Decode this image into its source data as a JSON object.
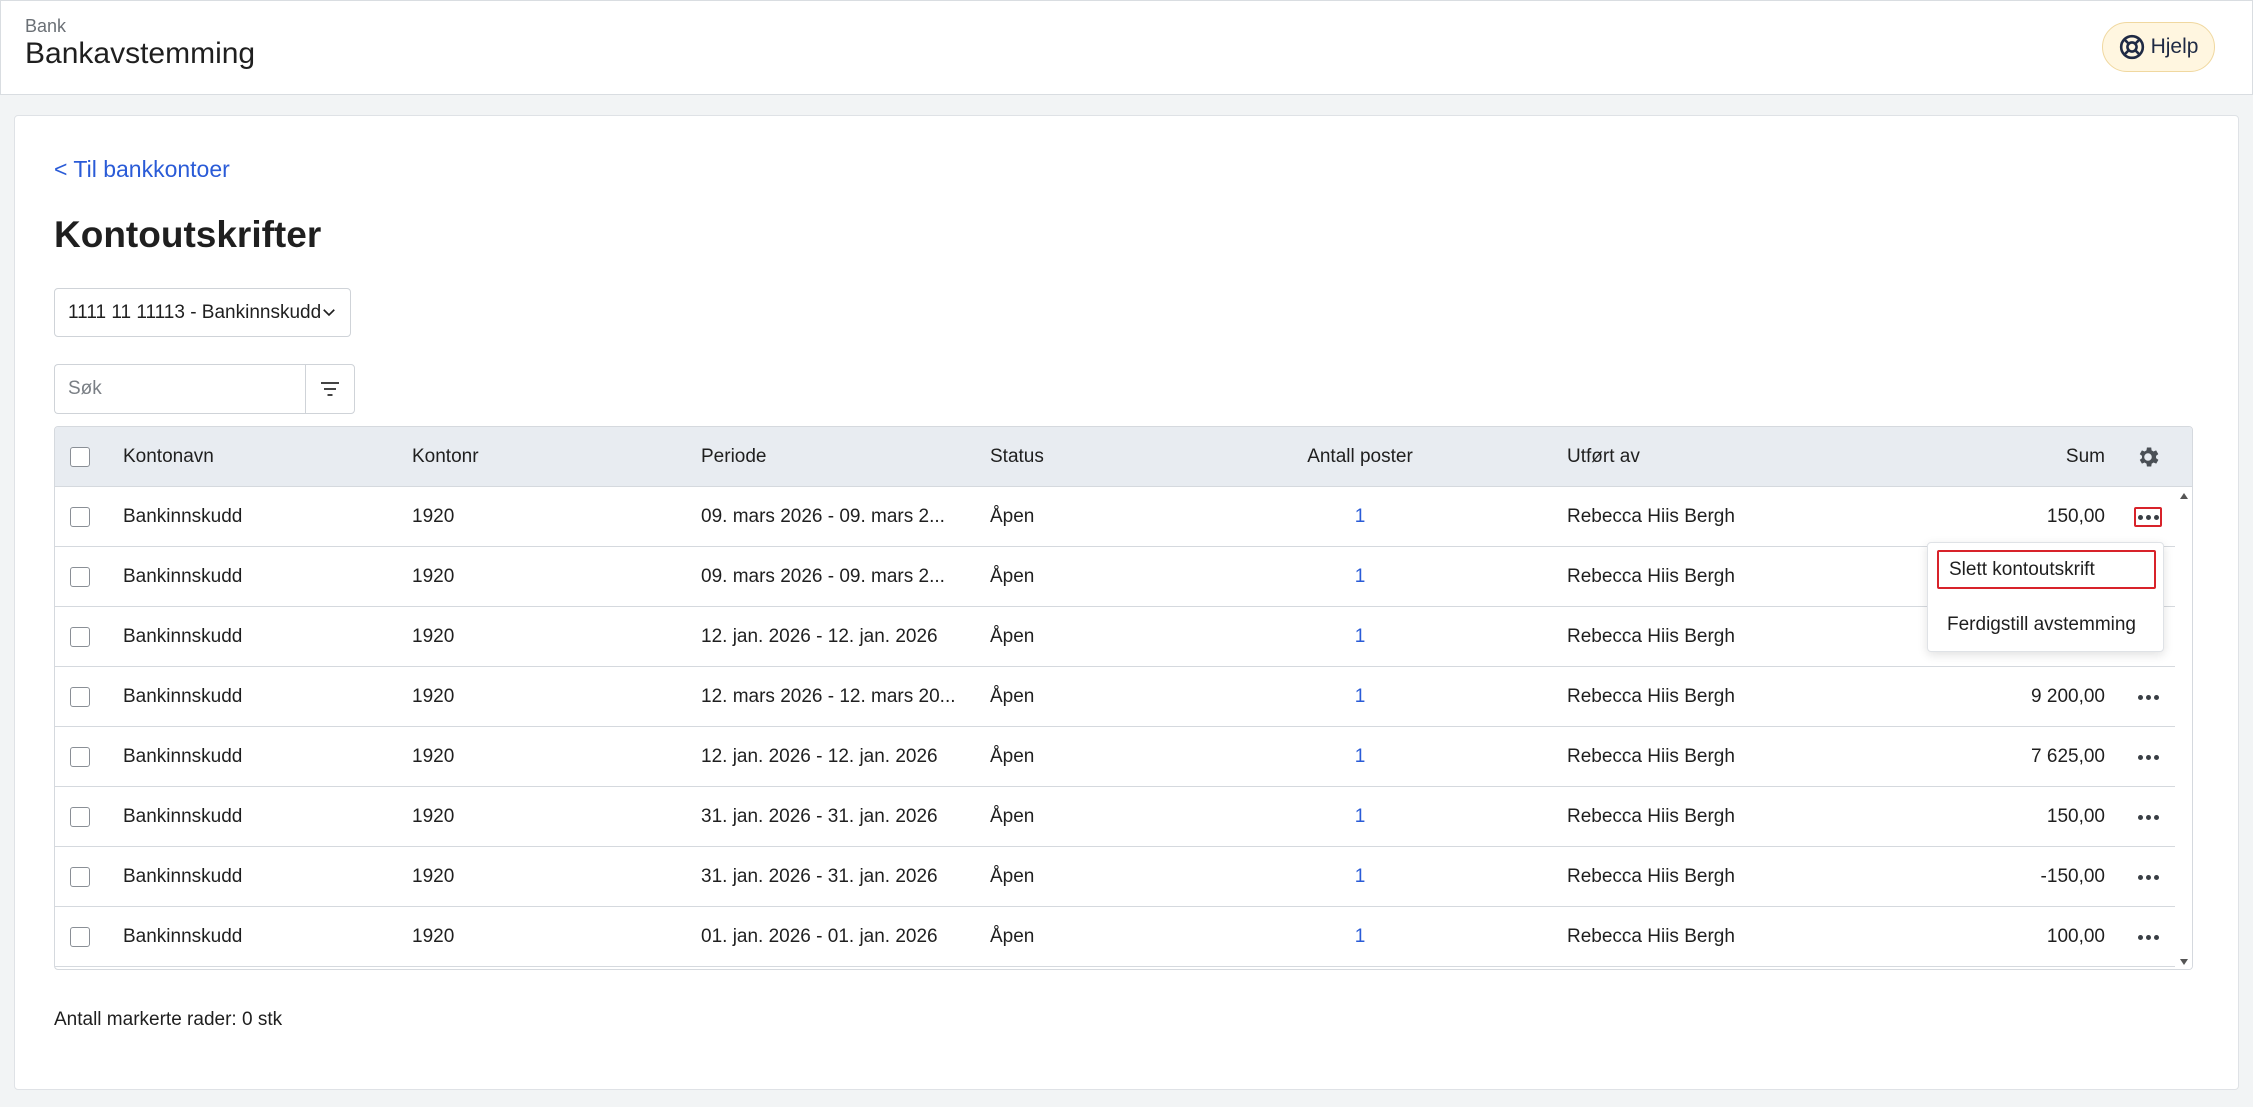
{
  "header": {
    "breadcrumb": "Bank",
    "title": "Bankavstemming",
    "help_label": "Hjelp"
  },
  "main": {
    "back_link": "< Til bankkontoer",
    "page_title": "Kontoutskrifter",
    "account_select": "1111 11 11113 - Bankinnskudd",
    "search_placeholder": "Søk"
  },
  "table": {
    "headers": {
      "kontonavn": "Kontonavn",
      "kontonr": "Kontonr",
      "periode": "Periode",
      "status": "Status",
      "antall": "Antall poster",
      "utfort": "Utført av",
      "sum": "Sum"
    },
    "rows": [
      {
        "kontonavn": "Bankinnskudd",
        "kontonr": "1920",
        "periode": "09. mars 2026 - 09. mars 2...",
        "status": "Åpen",
        "antall": "1",
        "utfort": "Rebecca Hiis Bergh",
        "sum": "150,00"
      },
      {
        "kontonavn": "Bankinnskudd",
        "kontonr": "1920",
        "periode": "09. mars 2026 - 09. mars 2...",
        "status": "Åpen",
        "antall": "1",
        "utfort": "Rebecca Hiis Bergh",
        "sum": ""
      },
      {
        "kontonavn": "Bankinnskudd",
        "kontonr": "1920",
        "periode": "12. jan. 2026 - 12. jan. 2026",
        "status": "Åpen",
        "antall": "1",
        "utfort": "Rebecca Hiis Bergh",
        "sum": ""
      },
      {
        "kontonavn": "Bankinnskudd",
        "kontonr": "1920",
        "periode": "12. mars 2026 - 12. mars 20...",
        "status": "Åpen",
        "antall": "1",
        "utfort": "Rebecca Hiis Bergh",
        "sum": "9 200,00"
      },
      {
        "kontonavn": "Bankinnskudd",
        "kontonr": "1920",
        "periode": "12. jan. 2026 - 12. jan. 2026",
        "status": "Åpen",
        "antall": "1",
        "utfort": "Rebecca Hiis Bergh",
        "sum": "7 625,00"
      },
      {
        "kontonavn": "Bankinnskudd",
        "kontonr": "1920",
        "periode": "31. jan. 2026 - 31. jan. 2026",
        "status": "Åpen",
        "antall": "1",
        "utfort": "Rebecca Hiis Bergh",
        "sum": "150,00"
      },
      {
        "kontonavn": "Bankinnskudd",
        "kontonr": "1920",
        "periode": "31. jan. 2026 - 31. jan. 2026",
        "status": "Åpen",
        "antall": "1",
        "utfort": "Rebecca Hiis Bergh",
        "sum": "-150,00"
      },
      {
        "kontonavn": "Bankinnskudd",
        "kontonr": "1920",
        "periode": "01. jan. 2026 - 01. jan. 2026",
        "status": "Åpen",
        "antall": "1",
        "utfort": "Rebecca Hiis Bergh",
        "sum": "100,00"
      }
    ]
  },
  "context_menu": {
    "delete_label": "Slett kontoutskrift",
    "finish_label": "Ferdigstill avstemming"
  },
  "footer": {
    "selected_label": "Antall markerte rader:",
    "selected_value": "0 stk"
  },
  "colors": {
    "link": "#2a5bd7",
    "highlight": "#d8232a",
    "header_bg": "#e8ecf1",
    "help_bg": "#fff6e0"
  },
  "icons": [
    "help-lifebuoy-icon",
    "chevron-down-icon",
    "filter-icon",
    "settings-gear-icon",
    "more-options-icon",
    "scroll-up-icon",
    "scroll-down-icon"
  ]
}
